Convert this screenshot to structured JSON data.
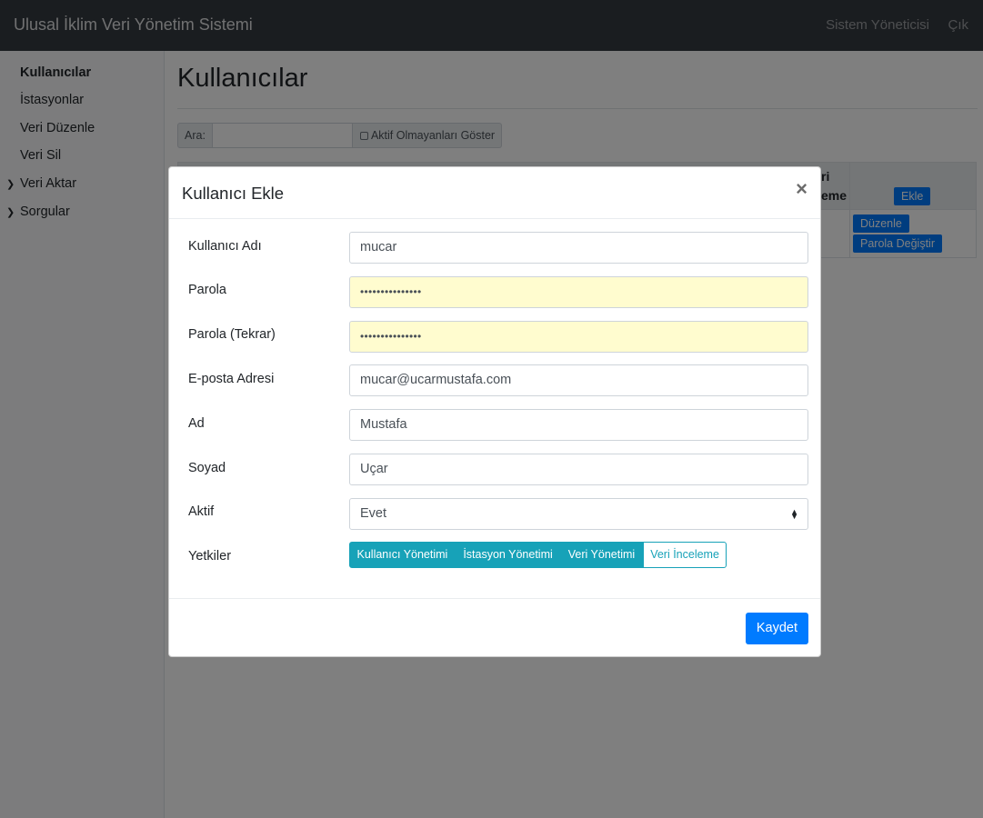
{
  "navbar": {
    "brand": "Ulusal İklim Veri Yönetim Sistemi",
    "admin_link": "Sistem Yöneticisi",
    "logout_link": "Çık"
  },
  "sidebar": {
    "items": [
      {
        "label": "Kullanıcılar",
        "active": true
      },
      {
        "label": "İstasyonlar"
      },
      {
        "label": "Veri Düzenle"
      },
      {
        "label": "Veri Sil"
      },
      {
        "label": "Veri Aktar",
        "expandable": true,
        "icon": "chevron-right-icon"
      },
      {
        "label": "Sorgular",
        "expandable": true,
        "icon": "chevron-right-icon"
      }
    ]
  },
  "main": {
    "title": "Kullanıcılar",
    "search_label": "Ara:",
    "search_value": "",
    "inactive_toggle_label": "Aktif Olmayanları Göster",
    "table_header_partial": [
      "ri",
      "eme"
    ],
    "add_button": "Ekle",
    "row_actions": {
      "edit": "Düzenle",
      "change_password": "Parola Değiştir"
    }
  },
  "modal": {
    "title": "Kullanıcı Ekle",
    "close_glyph": "×",
    "fields": {
      "username": {
        "label": "Kullanıcı Adı",
        "value": "mucar"
      },
      "password": {
        "label": "Parola",
        "value": "•••••••••••••••"
      },
      "password_repeat": {
        "label": "Parola (Tekrar)",
        "value": "•••••••••••••••"
      },
      "email": {
        "label": "E-posta Adresi",
        "value": "mucar@ucarmustafa.com"
      },
      "first_name": {
        "label": "Ad",
        "value": "Mustafa"
      },
      "last_name": {
        "label": "Soyad",
        "value": "Uçar"
      },
      "active": {
        "label": "Aktif",
        "value": "Evet"
      }
    },
    "permissions": {
      "label": "Yetkiler",
      "options": [
        {
          "label": "Kullanıcı Yönetimi",
          "selected": true
        },
        {
          "label": "İstasyon Yönetimi",
          "selected": true
        },
        {
          "label": "Veri Yönetimi",
          "selected": true
        },
        {
          "label": "Veri İnceleme",
          "selected": false
        }
      ]
    },
    "save_button": "Kaydet"
  },
  "colors": {
    "navbar_bg": "#343a40",
    "primary": "#007bff",
    "info": "#17a2b8",
    "autofill": "#fffccf",
    "backdrop": "rgba(0,0,0,0.5)"
  }
}
